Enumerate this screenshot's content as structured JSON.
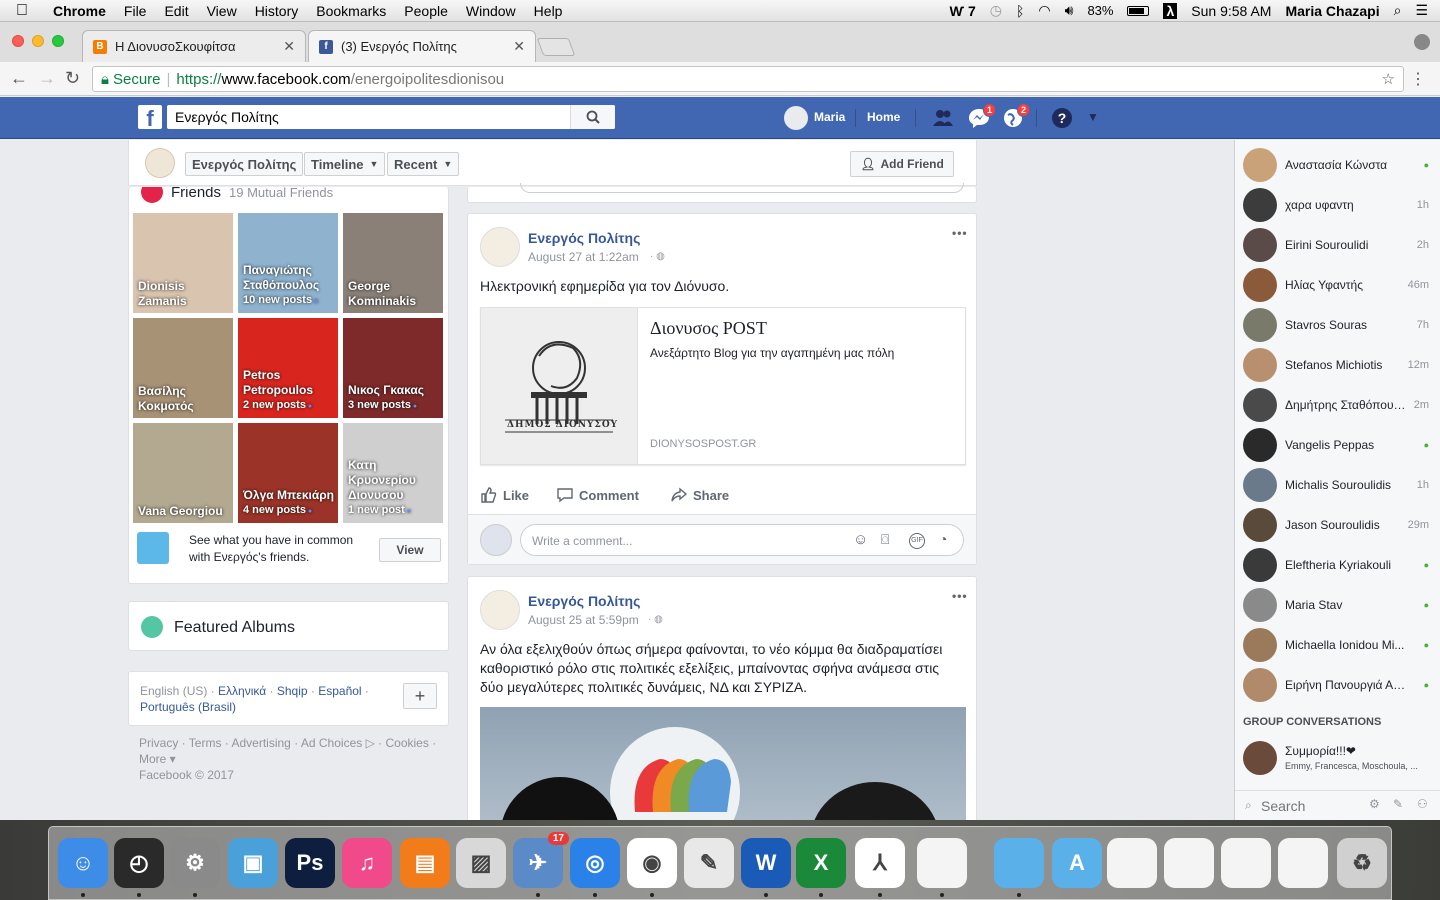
{
  "menubar": {
    "app": "Chrome",
    "items": [
      "File",
      "Edit",
      "View",
      "History",
      "Bookmarks",
      "People",
      "Window",
      "Help"
    ],
    "adobe_count": "7",
    "battery": "83%",
    "clock": "Sun 9:58 AM",
    "user": "Maria Chazapi"
  },
  "browser": {
    "tabs": [
      {
        "title": "Η ΔιονυσοΣκουφίτσα",
        "active": false,
        "favicon_color": "#f57d00"
      },
      {
        "title": "(3) Ενεργός Πολίτης",
        "active": true,
        "favicon_color": "#3b5998"
      }
    ],
    "secure_label": "Secure",
    "url_scheme": "https://",
    "url_host": "www.facebook.com",
    "url_path": "/energoipolitesdionisou"
  },
  "fb": {
    "search_value": "Ενεργός Πολίτης",
    "user_name": "Maria",
    "home_label": "Home",
    "messages_badge": "1",
    "notifications_badge": "2"
  },
  "timeline_header": {
    "page_name": "Ενεργός Πολίτης",
    "timeline_label": "Timeline",
    "recent_label": "Recent",
    "add_friend_label": "Add Friend"
  },
  "friends": {
    "title": "Friends",
    "mutual": "19 Mutual Friends",
    "tiles": [
      {
        "name": "Dionisis Zamanis",
        "posts": "",
        "color": "#d9c4b0"
      },
      {
        "name": "Παναγιώτης Σταθόπουλος",
        "posts": "10 new posts",
        "color": "#8fb3cf"
      },
      {
        "name": "George Komninakis",
        "posts": "",
        "color": "#8a8078"
      },
      {
        "name": "Βασίλης Κοκμοτός",
        "posts": "",
        "color": "#a89276"
      },
      {
        "name": "Petros Petropoulos",
        "posts": "2 new posts",
        "color": "#d8261f"
      },
      {
        "name": "Νικος Γκακας",
        "posts": "3 new posts",
        "color": "#7e2a2a"
      },
      {
        "name": "Vana Georgiou",
        "posts": "",
        "color": "#b3a991"
      },
      {
        "name": "Όλγα Μπεκιάρη",
        "posts": "4 new posts",
        "color": "#9c3328"
      },
      {
        "name": "Κατη Κρυονερίου Διονυσου",
        "posts": "1 new post",
        "color": "#cfcfcf"
      }
    ],
    "common_text": "See what you have in common with Ενεργός's friends.",
    "view_label": "View"
  },
  "featured_albums": {
    "title": "Featured Albums"
  },
  "languages": {
    "current": "English (US)",
    "others": [
      "Ελληνικά",
      "Shqip",
      "Español",
      "Português (Brasil)"
    ]
  },
  "footer": {
    "links": [
      "Privacy",
      "Terms",
      "Advertising",
      "Ad Choices",
      "Cookies",
      "More"
    ],
    "copyright": "Facebook © 2017"
  },
  "posts": [
    {
      "author": "Ενεργός Πολίτης",
      "time": "August 27 at 1:22am",
      "text": "Ηλεκτρονική εφημερίδα για τον Διόνυσο.",
      "link_title": "Διονυσος POST",
      "link_desc": "Ανεξάρτητο Blog για την αγαπημένη μας πόλη",
      "link_domain": "DIONYSOSPOST.GR",
      "link_logo_text": "ΔΗΜΟΣ ΔΙΟΝΥΣΟΥ"
    },
    {
      "author": "Ενεργός Πολίτης",
      "time": "August 25 at 5:59pm",
      "text": "Αν όλα εξελιχθούν όπως σήμερα φαίνονται, το νέο κόμμα θα διαδραματίσει καθοριστικό ρόλο στις πολιτικές εξελίξεις, μπαίνοντας σφήνα ανάμεσα στις δύο μεγαλύτερες πολιτικές δυνάμεις, ΝΔ και ΣΥΡΙΖΑ."
    }
  ],
  "actions": {
    "like": "Like",
    "comment": "Comment",
    "share": "Share"
  },
  "comment_placeholder": "Write a comment...",
  "chat": {
    "contacts": [
      {
        "name": "Αναστασία Κώνστα",
        "status": "●",
        "online": true,
        "color": "#c9a27a"
      },
      {
        "name": "χαρα υφαντη",
        "status": "1h",
        "online": false,
        "color": "#3c3c3c"
      },
      {
        "name": "Eirini Souroulidi",
        "status": "2h",
        "online": false,
        "color": "#5a4a48"
      },
      {
        "name": "Ηλίας Υφαντής",
        "status": "46m",
        "online": false,
        "color": "#8a5a3a"
      },
      {
        "name": "Stavros Souras",
        "status": "7h",
        "online": false,
        "color": "#7a7a6a"
      },
      {
        "name": "Stefanos Michiotis",
        "status": "12m",
        "online": false,
        "color": "#b89070"
      },
      {
        "name": "Δημήτρης Σταθόπουλος",
        "status": "2m",
        "online": false,
        "color": "#4a4a4a"
      },
      {
        "name": "Vangelis Peppas",
        "status": "●",
        "online": true,
        "color": "#2a2a2a"
      },
      {
        "name": "Michalis Souroulidis",
        "status": "1h",
        "online": false,
        "color": "#6a7a8a"
      },
      {
        "name": "Jason Souroulidis",
        "status": "29m",
        "online": false,
        "color": "#5a4a3a"
      },
      {
        "name": "Eleftheria Kyriakouli",
        "status": "●",
        "online": true,
        "color": "#3a3a3a"
      },
      {
        "name": "Maria Stav",
        "status": "●",
        "online": true,
        "color": "#8a8a8a"
      },
      {
        "name": "Michaella Ionidou Mi...",
        "status": "●",
        "online": true,
        "color": "#9a7a5a"
      },
      {
        "name": "Ειρήνη Πανουργιά Αμ...",
        "status": "●",
        "online": true,
        "color": "#b08a6a"
      }
    ],
    "group_title": "GROUP CONVERSATIONS",
    "group_name": "Συμμορία!!!❤",
    "group_members": "Emmy, Francesca, Moschoula, ...",
    "search_placeholder": "Search"
  },
  "dock": {
    "calendar_badge": "17",
    "apps": [
      "Finder",
      "Dashboard",
      "System Preferences",
      "Image Capture",
      "Photoshop",
      "iTunes",
      "iBooks",
      "Preview",
      "Mail",
      "Safari",
      "Chrome",
      "Pages",
      "Word",
      "Excel",
      "Acrobat",
      "Document",
      "Folder",
      "Applications",
      "Doc 1",
      "Doc 2",
      "Doc 3",
      "Doc 4",
      "Trash"
    ]
  }
}
